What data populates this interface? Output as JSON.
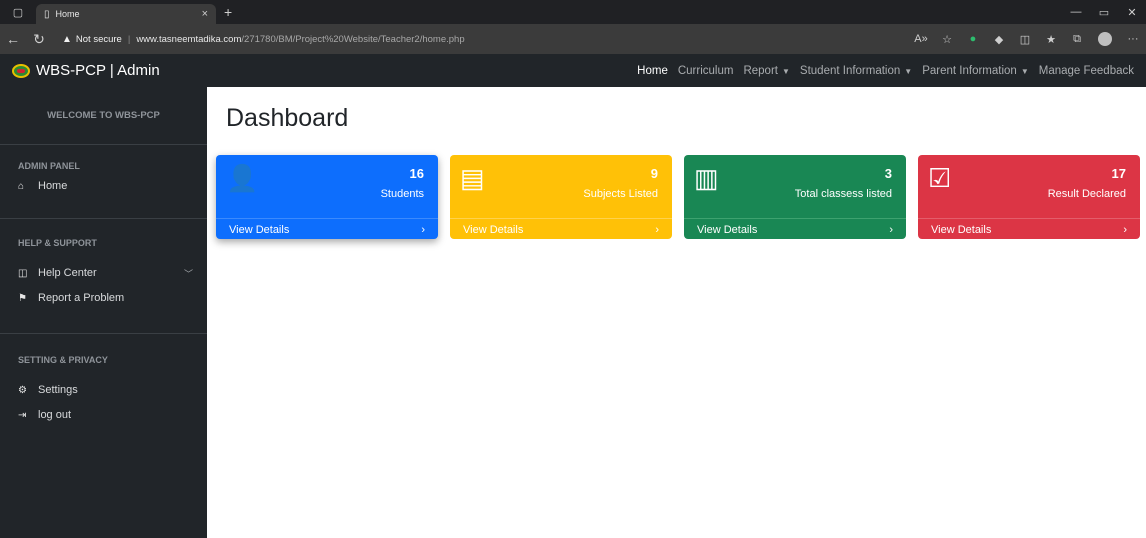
{
  "browser": {
    "tab_title": "Home",
    "tab_close": "×",
    "new_tab": "+",
    "not_secure": "Not secure",
    "url_host": "www.tasneemtadika.com",
    "url_path": "/271780/BM/Project%20Website/Teacher2/home.php",
    "tool_icons": [
      "read-aloud-icon",
      "favorite-icon",
      "extension-icon",
      "extension-icon",
      "split-screen-icon",
      "favorites-icon",
      "collections-icon",
      "profile-icon",
      "more-icon"
    ]
  },
  "navbar": {
    "brand": "WBS-PCP | Admin",
    "links": [
      {
        "label": "Home",
        "active": true,
        "dropdown": false
      },
      {
        "label": "Curriculum",
        "active": false,
        "dropdown": false
      },
      {
        "label": "Report",
        "active": false,
        "dropdown": true
      },
      {
        "label": "Student Information",
        "active": false,
        "dropdown": true
      },
      {
        "label": "Parent Information",
        "active": false,
        "dropdown": true
      },
      {
        "label": "Manage Feedback",
        "active": false,
        "dropdown": false
      }
    ]
  },
  "sidebar": {
    "welcome": "WELCOME TO WBS-PCP",
    "admin_panel": "ADMIN PANEL",
    "home": "Home",
    "help_support": "HELP & SUPPORT",
    "help_center": "Help Center",
    "report_problem": "Report a Problem",
    "setting_privacy": "SETTING & PRIVACY",
    "settings": "Settings",
    "logout": "log out"
  },
  "main": {
    "title": "Dashboard",
    "cards": [
      {
        "count": "16",
        "label": "Students",
        "footer": "View Details",
        "color": "#0d6efd",
        "icon": "user-check-icon"
      },
      {
        "count": "9",
        "label": "Subjects Listed",
        "footer": "View Details",
        "color": "#ffc107",
        "icon": "notebooks-icon"
      },
      {
        "count": "3",
        "label": "Total classess listed",
        "footer": "View Details",
        "color": "#198754",
        "icon": "buildings-icon"
      },
      {
        "count": "17",
        "label": "Result Declared",
        "footer": "View Details",
        "color": "#dc3545",
        "icon": "clipboard-check-icon"
      }
    ]
  }
}
